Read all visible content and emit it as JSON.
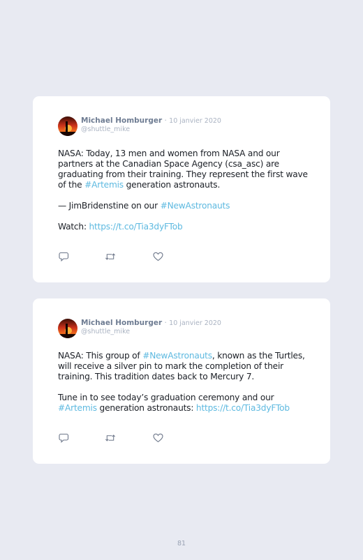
{
  "tweets": [
    {
      "author": "Michael Homburger",
      "separator": " · ",
      "date": "10 janvier 2020",
      "handle": "@shuttle_mike",
      "paragraphs": [
        [
          {
            "text": "NASA: Today, 13 men and women from NASA and our partners at the Canadian Space Agency (csa_asc) are graduating from their training. They represent the first wave of the "
          },
          {
            "text": "#Artemis",
            "link": true
          },
          {
            "text": " generation astronauts."
          }
        ],
        [
          {
            "text": "— JimBridenstine on our "
          },
          {
            "text": "#NewAstronauts",
            "link": true
          }
        ],
        [
          {
            "text": "Watch: "
          },
          {
            "text": "https://t.co/Tia3dyFTob",
            "link": true
          }
        ]
      ]
    },
    {
      "author": "Michael Homburger",
      "separator": " · ",
      "date": "10 janvier 2020",
      "handle": "@shuttle_mike",
      "paragraphs": [
        [
          {
            "text": "NASA: This group of "
          },
          {
            "text": "#NewAstronauts",
            "link": true
          },
          {
            "text": ", known as the Turtles, will receive a silver pin to mark the completion of their training. This tradition dates back to Mercury 7."
          }
        ],
        [
          {
            "text": "Tune in to see today’s graduation ceremony and our "
          },
          {
            "text": "#Artemis",
            "link": true
          },
          {
            "text": " generation astronauts: "
          },
          {
            "text": "https://t.co/Tia3dyFTob",
            "link": true
          }
        ]
      ]
    }
  ],
  "icons": {
    "reply": "reply-icon",
    "retweet": "retweet-icon",
    "like": "heart-icon",
    "avatar": "sunset-avatar"
  },
  "colors": {
    "link": "#5db9e0",
    "author": "#6f7d93",
    "muted": "#aab3c2",
    "background": "#e8eaf2"
  },
  "page_number": "81"
}
